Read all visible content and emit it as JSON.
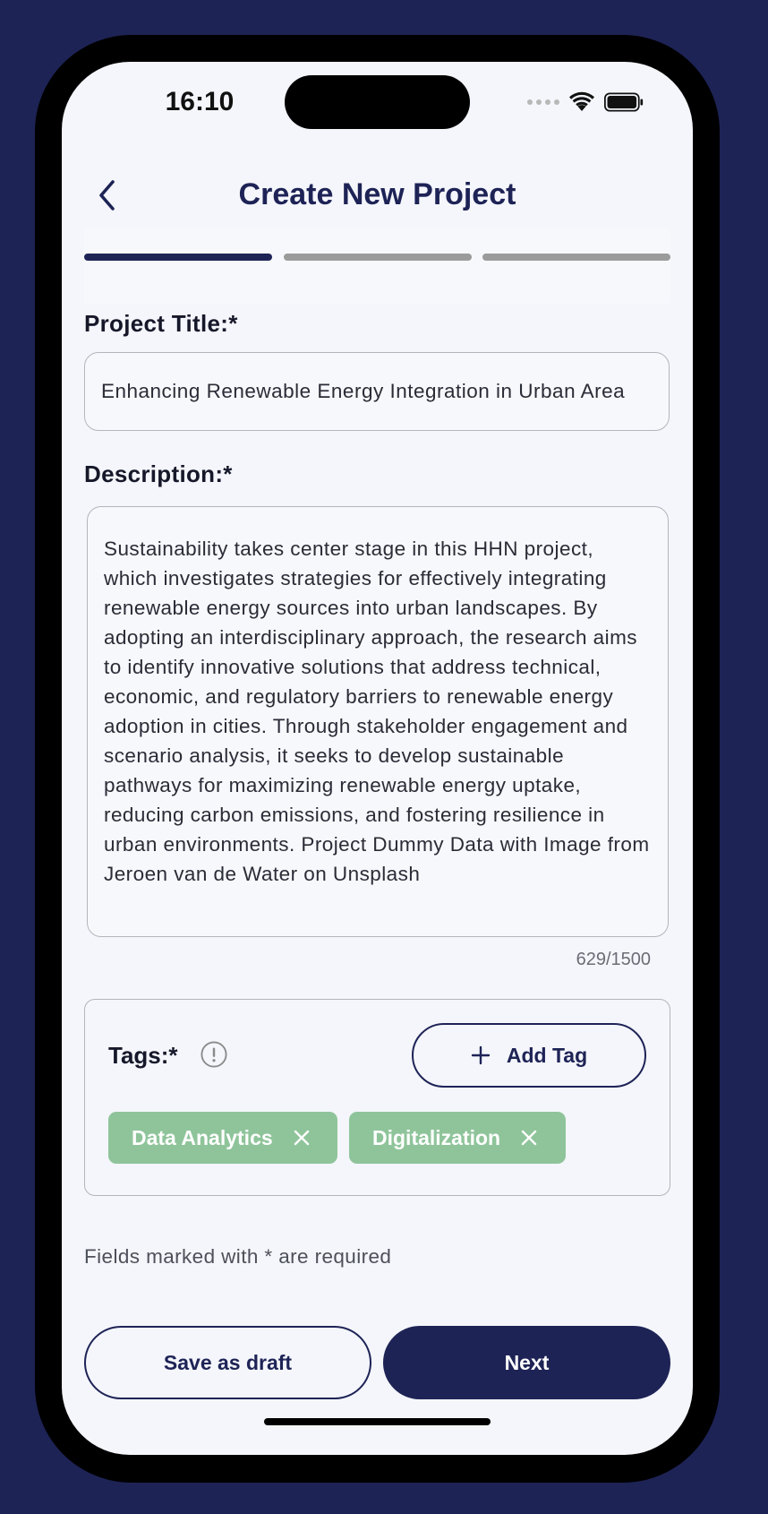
{
  "status_bar": {
    "time": "16:10"
  },
  "header": {
    "title": "Create New Project",
    "back_icon": "chevron-left-icon"
  },
  "progress": {
    "total_steps": 3,
    "current_step": 1,
    "active_color": "#1e2356",
    "inactive_color": "#9b9b9b"
  },
  "form": {
    "title_label": "Project Title:*",
    "title_value": "Enhancing Renewable Energy Integration in Urban Area",
    "description_label": "Description:*",
    "description_value": "Sustainability takes center stage in this HHN project, which investigates strategies for effectively integrating renewable energy sources into urban landscapes. By adopting an interdisciplinary approach, the research aims to identify innovative solutions that address technical, economic, and regulatory barriers to renewable energy adoption in cities. Through stakeholder engagement and scenario analysis, it seeks to develop sustainable pathways for maximizing renewable energy uptake, reducing carbon emissions, and fostering resilience in urban environments. Project Dummy Data with Image from Jeroen van de Water on Unsplash",
    "char_count": "629/1500"
  },
  "tags": {
    "label": "Tags:*",
    "info_icon": "info-icon",
    "add_button_label": "Add Tag",
    "add_icon": "plus-icon",
    "items": [
      {
        "label": "Data Analytics"
      },
      {
        "label": "Digitalization"
      }
    ],
    "chip_color": "#8fc49a"
  },
  "required_note": "Fields marked with * are required",
  "actions": {
    "draft_label": "Save as draft",
    "next_label": "Next"
  }
}
